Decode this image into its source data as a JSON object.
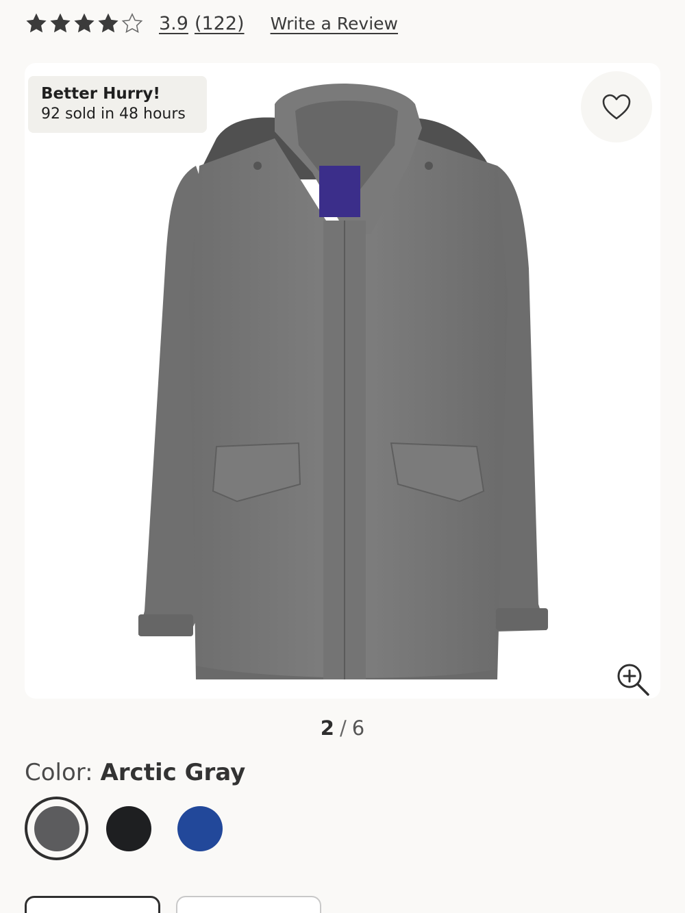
{
  "rating": {
    "value": "3.9",
    "count": "(122)",
    "stars_filled": 4,
    "stars_total": 5,
    "write_review": "Write a Review"
  },
  "gallery": {
    "badge_title": "Better Hurry!",
    "badge_subtitle": "92 sold in 48 hours",
    "current_index": "2",
    "separator": "/",
    "total": "6",
    "image_subject": "gray hooded rain jacket",
    "favorite_icon": "heart-icon",
    "zoom_icon": "zoom-in-icon"
  },
  "color": {
    "label": "Color:",
    "selected": "Arctic Gray",
    "swatches": [
      {
        "color": "#5c5c5e",
        "selected": true
      },
      {
        "color": "#1e1f21",
        "selected": false
      },
      {
        "color": "#22489a",
        "selected": false
      }
    ]
  },
  "colors": {
    "text": "#2f2f2f",
    "background": "#faf9f7",
    "badge_bg": "#f1f0ec"
  }
}
